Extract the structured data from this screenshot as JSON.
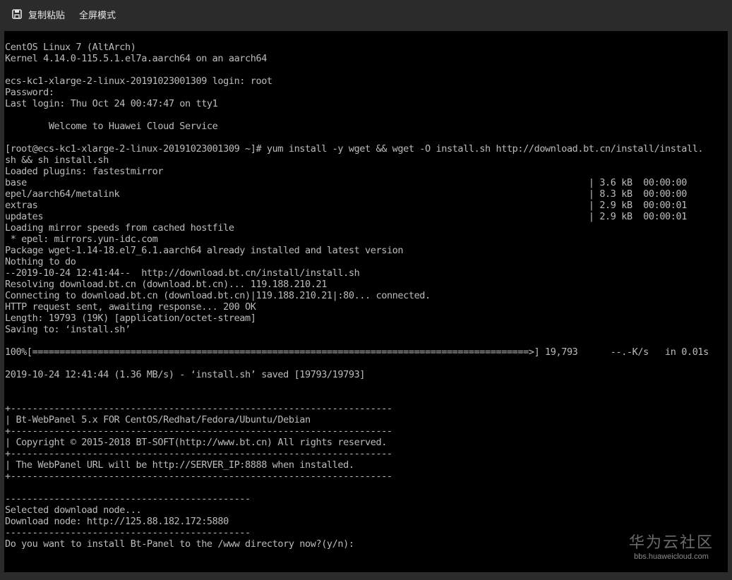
{
  "toolbar": {
    "copy_paste_label": "复制粘贴",
    "fullscreen_label": "全屏模式",
    "copy_paste_icon": "save-icon"
  },
  "terminal": {
    "lines": [
      "CentOS Linux 7 (AltArch)",
      "Kernel 4.14.0-115.5.1.el7a.aarch64 on an aarch64",
      "",
      "ecs-kc1-xlarge-2-linux-20191023001309 login: root",
      "Password:",
      "Last login: Thu Oct 24 00:47:47 on tty1",
      "",
      "        Welcome to Huawei Cloud Service",
      "",
      "[root@ecs-kc1-xlarge-2-linux-20191023001309 ~]# yum install -y wget && wget -O install.sh http://download.bt.cn/install/install.",
      "sh && sh install.sh",
      "Loaded plugins: fastestmirror",
      "base                                                                                                       | 3.6 kB  00:00:00",
      "epel/aarch64/metalink                                                                                      | 8.3 kB  00:00:00",
      "extras                                                                                                     | 2.9 kB  00:00:01",
      "updates                                                                                                    | 2.9 kB  00:00:01",
      "Loading mirror speeds from cached hostfile",
      " * epel: mirrors.yun-idc.com",
      "Package wget-1.14-18.el7_6.1.aarch64 already installed and latest version",
      "Nothing to do",
      "--2019-10-24 12:41:44--  http://download.bt.cn/install/install.sh",
      "Resolving download.bt.cn (download.bt.cn)... 119.188.210.21",
      "Connecting to download.bt.cn (download.bt.cn)|119.188.210.21|:80... connected.",
      "HTTP request sent, awaiting response... 200 OK",
      "Length: 19793 (19K) [application/octet-stream]",
      "Saving to: ‘install.sh’",
      "",
      "100%[===========================================================================================>] 19,793      --.-K/s   in 0.01s",
      "",
      "2019-10-24 12:41:44 (1.36 MB/s) - ‘install.sh’ saved [19793/19793]",
      "",
      "",
      "+----------------------------------------------------------------------",
      "| Bt-WebPanel 5.x FOR CentOS/Redhat/Fedora/Ubuntu/Debian",
      "+----------------------------------------------------------------------",
      "| Copyright © 2015-2018 BT-SOFT(http://www.bt.cn) All rights reserved.",
      "+----------------------------------------------------------------------",
      "| The WebPanel URL will be http://SERVER_IP:8888 when installed.",
      "+----------------------------------------------------------------------",
      "",
      "---------------------------------------------",
      "Selected download node...",
      "Download node: http://125.88.182.172:5880",
      "---------------------------------------------",
      "Do you want to install Bt-Panel to the /www directory now?(y/n):"
    ]
  },
  "watermark": {
    "title": "华为云社区",
    "url": "bbs.huaweicloud.com"
  }
}
